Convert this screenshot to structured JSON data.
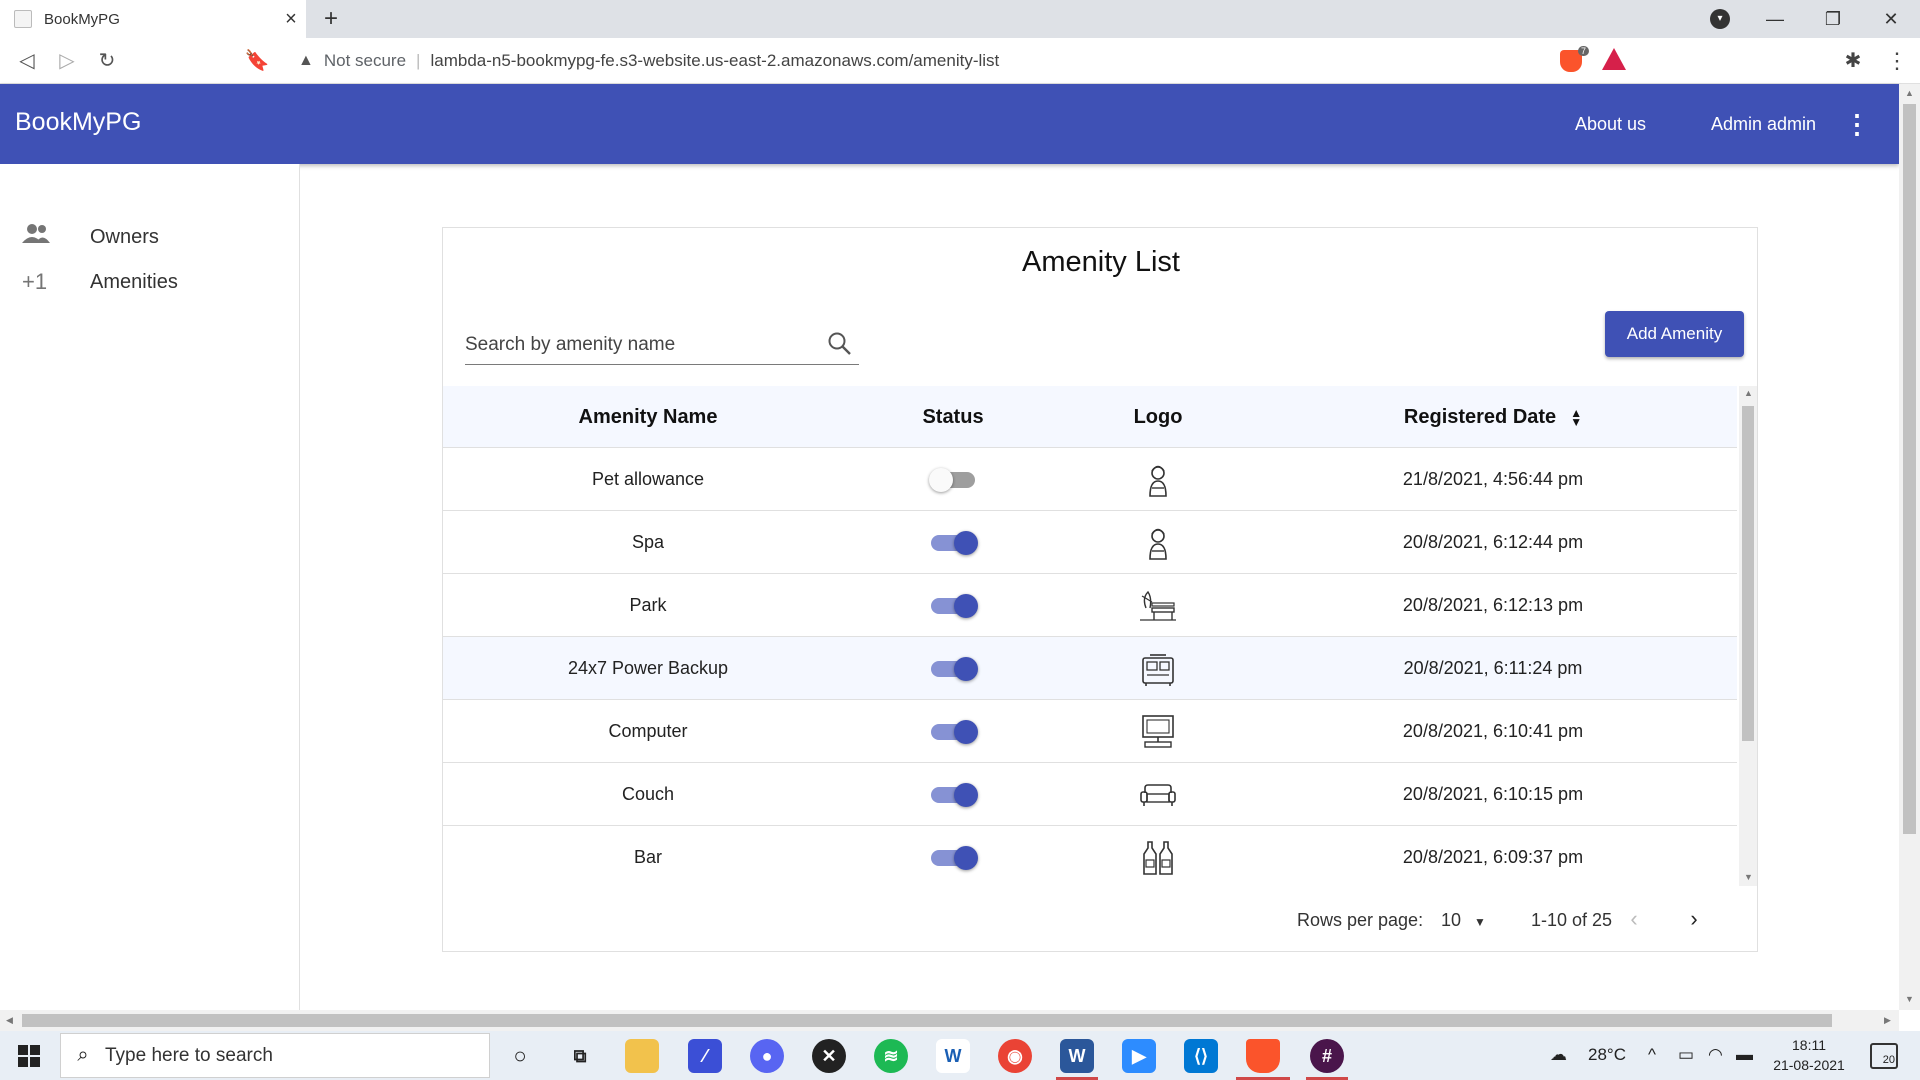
{
  "browser": {
    "tab_title": "BookMyPG",
    "tab_close": "×",
    "new_tab": "+",
    "security_label": "Not secure",
    "url": "lambda-n5-bookmypg-fe.s3-website.us-east-2.amazonaws.com/amenity-list",
    "shield_count": "7"
  },
  "appbar": {
    "brand": "BookMyPG",
    "about": "About us",
    "user": "Admin admin",
    "more": "⋮"
  },
  "sidebar": {
    "items": [
      {
        "label": "Owners",
        "icon": "people-icon",
        "glyph": "👥"
      },
      {
        "label": "Amenities",
        "icon": "plus-one-icon",
        "glyph": "+1"
      }
    ]
  },
  "main": {
    "title": "Amenity List",
    "search_placeholder": "Search by amenity name",
    "add_button": "Add Amenity",
    "columns": [
      "Amenity Name",
      "Status",
      "Logo",
      "Registered Date"
    ],
    "rows": [
      {
        "name": "Pet allowance",
        "status": false,
        "logo": "spa-person-icon",
        "date": "21/8/2021, 4:56:44 pm"
      },
      {
        "name": "Spa",
        "status": true,
        "logo": "spa-person-icon",
        "date": "20/8/2021, 6:12:44 pm"
      },
      {
        "name": "Park",
        "status": true,
        "logo": "park-bench-icon",
        "date": "20/8/2021, 6:12:13 pm"
      },
      {
        "name": "24x7 Power Backup",
        "status": true,
        "logo": "generator-icon",
        "date": "20/8/2021, 6:11:24 pm"
      },
      {
        "name": "Computer",
        "status": true,
        "logo": "computer-icon",
        "date": "20/8/2021, 6:10:41 pm"
      },
      {
        "name": "Couch",
        "status": true,
        "logo": "couch-icon",
        "date": "20/8/2021, 6:10:15 pm"
      },
      {
        "name": "Bar",
        "status": true,
        "logo": "bottles-icon",
        "date": "20/8/2021, 6:09:37 pm"
      }
    ],
    "pagination": {
      "rows_label": "Rows per page:",
      "rows_value": "10",
      "range": "1-10 of 25"
    }
  },
  "taskbar": {
    "search_placeholder": "Type here to search",
    "temperature": "28°C",
    "time": "18:11",
    "date": "21-08-2021",
    "notifications": "20"
  },
  "colors": {
    "primary": "#3f51b5",
    "toggle_track_on": "#8692d4",
    "header_bg": "#f5f8ff"
  }
}
